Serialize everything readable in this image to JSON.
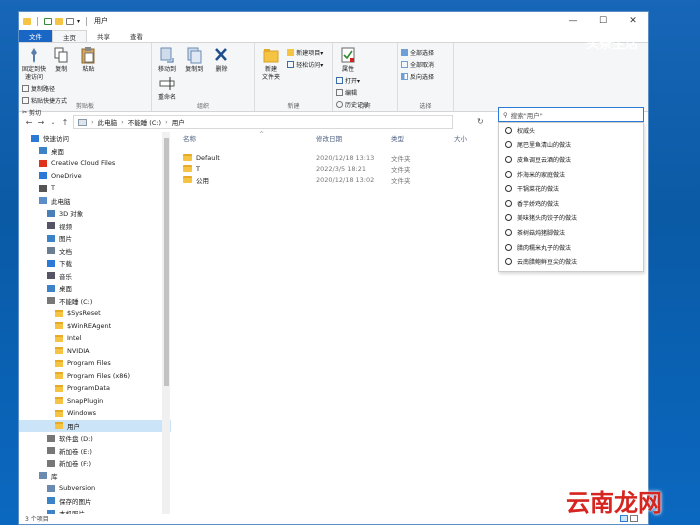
{
  "titlebar": {
    "title": "用户"
  },
  "window_controls": {
    "minimize": "—",
    "maximize": "☐",
    "close": "✕"
  },
  "tabs": [
    "文件",
    "主页",
    "共享",
    "查看"
  ],
  "ribbon": {
    "clipboard": {
      "label": "剪贴板",
      "pin": "固定到快速访问",
      "copy": "复制",
      "paste": "粘贴",
      "copy_path": "复制路径",
      "paste_shortcut": "粘贴快捷方式",
      "cut": "剪切"
    },
    "organize": {
      "label": "组织",
      "move_to": "移动到",
      "copy_to": "复制到",
      "delete": "删除",
      "rename": "重命名"
    },
    "new": {
      "label": "新建",
      "new_folder": "新建\n文件夹",
      "new_item": "新建项目▾",
      "easy_access": "轻松访问▾"
    },
    "open": {
      "label": "打开",
      "properties": "属性",
      "open": "打开▾",
      "edit": "编辑",
      "history": "历史记录"
    },
    "select": {
      "label": "选择",
      "select_all": "全部选择",
      "select_none": "全部取消",
      "invert": "反向选择"
    }
  },
  "address": {
    "pc": "此电脑",
    "drive": "不能睡 (C:)",
    "folder": "用户"
  },
  "search": {
    "placeholder": "搜索\"用户\""
  },
  "suggestions": [
    "权威头",
    "尾巴里鱼清山的做法",
    "皮鱼调豆云酒的做法",
    "炸海米的家庭做法",
    "干锅菜花的做法",
    "香芋娇鸡的做法",
    "美味猪头肉饺子的做法",
    "茶树菇炖猪脚做法",
    "腊肉糯米丸子的做法",
    "云南腊鲍鲜豆尖的做法"
  ],
  "sidebar": [
    {
      "label": "快速访问",
      "indent": 0,
      "icon": "star"
    },
    {
      "label": "桌面",
      "indent": 1,
      "icon": "desk"
    },
    {
      "label": "Creative Cloud Files",
      "indent": 1,
      "icon": "cc"
    },
    {
      "label": "OneDrive",
      "indent": 1,
      "icon": "cloud"
    },
    {
      "label": "T",
      "indent": 1,
      "icon": "user"
    },
    {
      "label": "此电脑",
      "indent": 1,
      "icon": "pc"
    },
    {
      "label": "3D 对象",
      "indent": 2,
      "icon": "3d"
    },
    {
      "label": "视频",
      "indent": 2,
      "icon": "video"
    },
    {
      "label": "图片",
      "indent": 2,
      "icon": "pic"
    },
    {
      "label": "文档",
      "indent": 2,
      "icon": "doc"
    },
    {
      "label": "下载",
      "indent": 2,
      "icon": "dl"
    },
    {
      "label": "音乐",
      "indent": 2,
      "icon": "music"
    },
    {
      "label": "桌面",
      "indent": 2,
      "icon": "desk"
    },
    {
      "label": "不能睡 (C:)",
      "indent": 2,
      "icon": "drive"
    },
    {
      "label": "$SysReset",
      "indent": 3,
      "icon": "folder"
    },
    {
      "label": "$WinREAgent",
      "indent": 3,
      "icon": "folder"
    },
    {
      "label": "Intel",
      "indent": 3,
      "icon": "folder"
    },
    {
      "label": "NVIDIA",
      "indent": 3,
      "icon": "folder"
    },
    {
      "label": "Program Files",
      "indent": 3,
      "icon": "folder"
    },
    {
      "label": "Program Files (x86)",
      "indent": 3,
      "icon": "folder"
    },
    {
      "label": "ProgramData",
      "indent": 3,
      "icon": "folder"
    },
    {
      "label": "SnapPlugin",
      "indent": 3,
      "icon": "folder"
    },
    {
      "label": "Windows",
      "indent": 3,
      "icon": "folder"
    },
    {
      "label": "用户",
      "indent": 3,
      "icon": "folder",
      "selected": true
    },
    {
      "label": "软件盘 (D:)",
      "indent": 2,
      "icon": "drive"
    },
    {
      "label": "新加卷 (E:)",
      "indent": 2,
      "icon": "drive"
    },
    {
      "label": "新加卷 (F:)",
      "indent": 2,
      "icon": "drive"
    },
    {
      "label": "库",
      "indent": 1,
      "icon": "lib"
    },
    {
      "label": "Subversion",
      "indent": 2,
      "icon": "lib"
    },
    {
      "label": "保存的图片",
      "indent": 2,
      "icon": "pic"
    },
    {
      "label": "本机照片",
      "indent": 2,
      "icon": "pic"
    }
  ],
  "columns": {
    "name": "名称",
    "date": "修改日期",
    "type": "类型",
    "size": "大小"
  },
  "files": [
    {
      "name": "Default",
      "date": "2020/12/18 13:13",
      "type": "文件夹"
    },
    {
      "name": "T",
      "date": "2022/3/5 18:21",
      "type": "文件夹"
    },
    {
      "name": "公用",
      "date": "2020/12/18 13:02",
      "type": "文件夹"
    }
  ],
  "status": {
    "count": "3 个项目"
  },
  "watermarks": {
    "top": "头条生活",
    "bottom": "云南龙网"
  },
  "colors": {
    "accent": "#1a66c4",
    "folder": "#f5c443",
    "selected": "#cce4f7",
    "watermark": "#d6241f"
  }
}
